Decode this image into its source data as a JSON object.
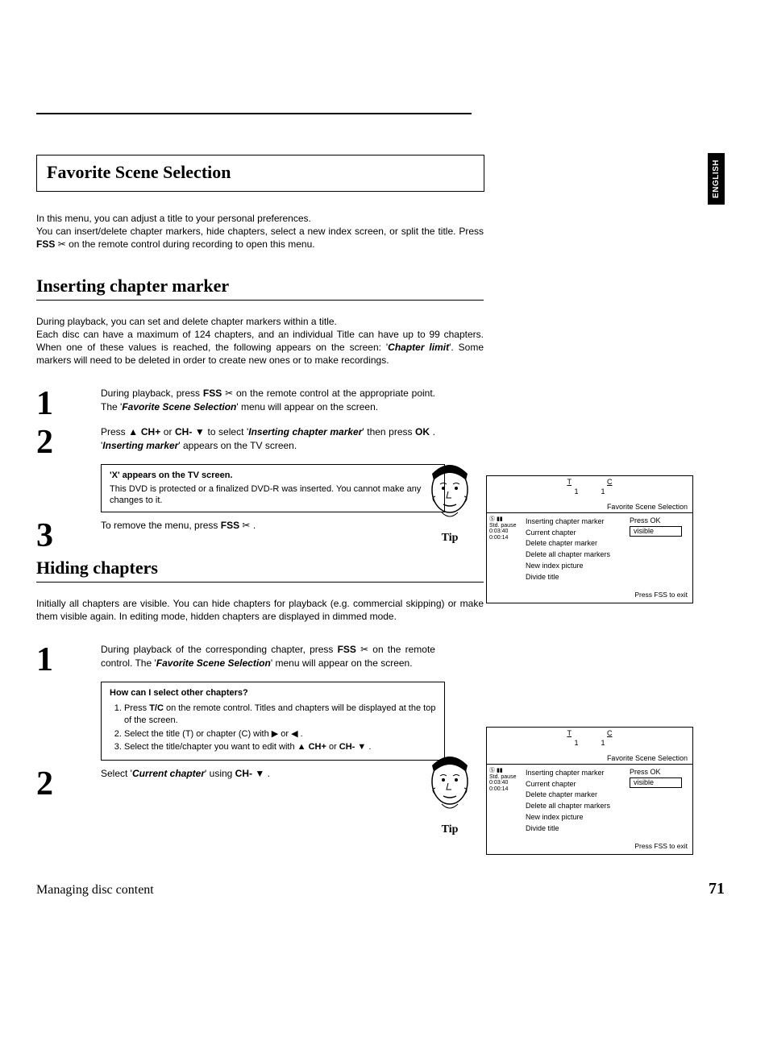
{
  "lang_tab": "ENGLISH",
  "title": "Favorite Scene Selection",
  "intro": {
    "line1": "In this menu, you can adjust a title to your personal preferences.",
    "line2_a": "You can insert/delete chapter markers, hide chapters, select a new index screen, or split the title. Press ",
    "fss": "FSS",
    "scissors": "✂",
    "line2_b": " on the remote control during recording to open this menu."
  },
  "sec1": {
    "heading": "Inserting chapter marker",
    "para_a": "During playback, you can set and delete chapter markers within a title.",
    "para_b": "Each disc can have a maximum of 124 chapters, and an individual Title can have up to 99 chapters. When one of these values is reached, the following appears on the screen: '",
    "chapter_limit": "Chapter limit",
    "para_c": "'. Some markers will need to be deleted in order to create new ones or to make recordings.",
    "step1": {
      "num": "1",
      "a": "During playback, press ",
      "fss": "FSS",
      "sc": "✂",
      "b": " on the remote control at the appropriate point. The '",
      "menu": "Favorite Scene Selection",
      "c": "' menu will appear on the screen."
    },
    "step2": {
      "num": "2",
      "a": "Press ",
      "up": "▲",
      "chplus": "CH+",
      "or": " or ",
      "chminus": "CH-",
      "down": "▼",
      "b": " to select '",
      "ins": "Inserting chapter marker",
      "c": "' then press ",
      "ok": "OK",
      "d": " . '",
      "insm": "Inserting marker",
      "e": "' appears on the TV screen."
    },
    "note": {
      "title": "'X' appears on the TV screen.",
      "body": "This DVD is protected or a finalized DVD-R was inserted. You cannot make any changes to it."
    },
    "step3": {
      "num": "3",
      "a": "To remove the menu, press ",
      "fss": "FSS",
      "sc": "✂",
      "b": " ."
    }
  },
  "sec2": {
    "heading": "Hiding chapters",
    "para": "Initially all chapters are visible. You can hide chapters for playback (e.g. commercial skipping) or make them visible again. In editing mode, hidden chapters are displayed in dimmed mode.",
    "step1": {
      "num": "1",
      "a": "During playback of the corresponding chapter, press ",
      "fss": "FSS",
      "sc": "✂",
      "b": " on the remote control. The '",
      "menu": "Favorite Scene Selection",
      "c": "' menu will appear on the screen."
    },
    "note": {
      "title": "How can I select other chapters?",
      "i1a": "Press ",
      "tc": "T/C",
      "i1b": " on the remote control. Titles and chapters will be displayed at the top of the screen.",
      "i2a": "Select the title (T) or chapter (C) with ",
      "right": "▶",
      "or": " or ",
      "left": "◀",
      "i2b": " .",
      "i3a": "Select the title/chapter you want to edit with ",
      "up": "▲",
      "chplus": "CH+",
      "chminus": "CH-",
      "down": "▼",
      "i3b": " ."
    },
    "step2": {
      "num": "2",
      "a": "Select '",
      "cur": "Current chapter",
      "b": "' using ",
      "chminus": "CH-",
      "down": "▼",
      "c": " ."
    }
  },
  "tip": "Tip",
  "menu": {
    "T": "T",
    "C": "C",
    "n1": "1",
    "n2": "1",
    "left_icons": "Ⓢ ▮▮",
    "left_pause": "Std. pause",
    "left_t1": "0:03:40",
    "left_t2": "0:00:14",
    "title": "Favorite Scene Selection",
    "items": [
      "Inserting chapter marker",
      "Current chapter",
      "Delete chapter marker",
      "Delete all chapter markers",
      "New index picture",
      "Divide title"
    ],
    "pressok": "Press OK",
    "visible": "visible",
    "exit": "Press FSS to exit"
  },
  "footer": {
    "left": "Managing disc content",
    "right": "71"
  }
}
